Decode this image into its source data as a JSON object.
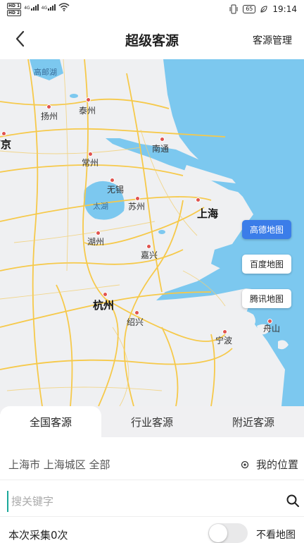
{
  "status_bar": {
    "hd1": "HD",
    "hd1_num": "1",
    "hd2": "HD",
    "hd2_num": "2",
    "net1": "4G",
    "net2": "4G",
    "battery": "65",
    "time": "19:14",
    "icons": [
      "signal-icon",
      "wifi-icon",
      "vibrate-icon",
      "leaf-icon"
    ]
  },
  "header": {
    "title": "超级客源",
    "right_link": "客源管理",
    "back_icon": "chevron-left-icon"
  },
  "map": {
    "cities": {
      "gaoyouhu": "高邮湖",
      "yangzhou": "扬州",
      "taizhou": "泰州",
      "nanjing": "南京",
      "nantong": "南通",
      "changzhou": "常州",
      "wuxi": "无锡",
      "taihu": "太湖",
      "suzhou": "苏州",
      "shanghai": "上海",
      "huzhou": "湖州",
      "jiaxing": "嘉兴",
      "hangzhou": "杭州",
      "shaoxing": "绍兴",
      "ningbo": "宁波",
      "zhoushan": "舟山"
    },
    "providers": [
      {
        "label": "高德地图",
        "active": true
      },
      {
        "label": "百度地图",
        "active": false
      },
      {
        "label": "腾讯地图",
        "active": false
      }
    ],
    "colors": {
      "sea": "#7cc8ef",
      "land": "#eff0f2",
      "road": "#f6c94a",
      "active": "#3b7de9"
    }
  },
  "tabs": [
    {
      "label": "全国客源",
      "active": true
    },
    {
      "label": "行业客源",
      "active": false
    },
    {
      "label": "附近客源",
      "active": false
    }
  ],
  "location": {
    "region": "上海市 上海城区 全部",
    "my_location": "我的位置"
  },
  "search": {
    "placeholder": "搜关键字",
    "value": ""
  },
  "collect": {
    "text": "本次采集0次",
    "toggle_label": "不看地图",
    "toggle_on": false
  }
}
